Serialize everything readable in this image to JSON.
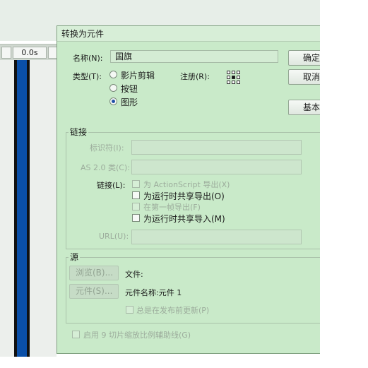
{
  "timeline": {
    "time": "0.0s"
  },
  "dialog": {
    "title": "转换为元件",
    "name_label": "名称(N):",
    "name_value": "国旗",
    "type_label": "类型(T):",
    "types": [
      {
        "label": "影片剪辑",
        "selected": false
      },
      {
        "label": "按钮",
        "selected": false
      },
      {
        "label": "图形",
        "selected": true
      }
    ],
    "registration_label": "注册(R):",
    "buttons": {
      "ok": "确定",
      "cancel": "取消",
      "basic": "基本"
    },
    "linkage": {
      "title": "链接",
      "identifier_label": "标识符(I):",
      "as2_class_label": "AS 2.0 类(C):",
      "linkage_label": "链接(L):",
      "options": [
        {
          "label": "为 ActionScript 导出(X)",
          "enabled": false,
          "checked": false
        },
        {
          "label": "为运行时共享导出(O)",
          "enabled": true,
          "checked": false
        },
        {
          "label": "在第一帧导出(F)",
          "enabled": false,
          "checked": false
        },
        {
          "label": "为运行时共享导入(M)",
          "enabled": true,
          "checked": false
        }
      ],
      "url_label": "URL(U):"
    },
    "source": {
      "title": "源",
      "browse_button": "浏览(B)...",
      "symbol_button": "元件(S)...",
      "file_label": "文件:",
      "symbol_name_label": "元件名称:元件 1",
      "always_update": "总是在发布前更新(P)"
    },
    "enable_9slice": "启用 9 切片缩放比例辅助线(G)"
  }
}
